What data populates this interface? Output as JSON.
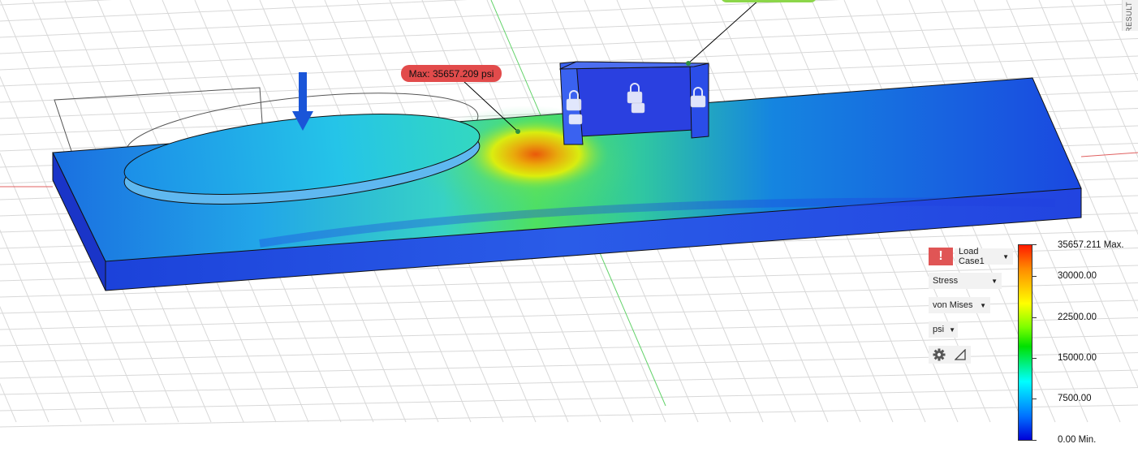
{
  "max_marker": {
    "label": "Max: 35657.209 psi"
  },
  "results_panel": {
    "warning_icon": "exclamation-icon",
    "load_case": "Load Case1",
    "result_type": "Stress",
    "stress_component": "von Mises",
    "units": "psi",
    "settings_icon": "gear-icon",
    "scale_icon": "scale-triangle-icon"
  },
  "legend": {
    "max_label": "35657.211 Max.",
    "labels": [
      "30000.00",
      "22500.00",
      "15000.00",
      "7500.00"
    ],
    "min_label": "0.00 Min.",
    "colors": [
      "#ff1a00",
      "#ff8a00",
      "#ffff00",
      "#7fff00",
      "#00e000",
      "#00ffff",
      "#0070ff",
      "#0000d8"
    ]
  },
  "side_tab": {
    "label": "RESULT"
  },
  "viewport_icons": {
    "load_arrow": "down-arrow-icon",
    "constraint": "lock-icon"
  }
}
